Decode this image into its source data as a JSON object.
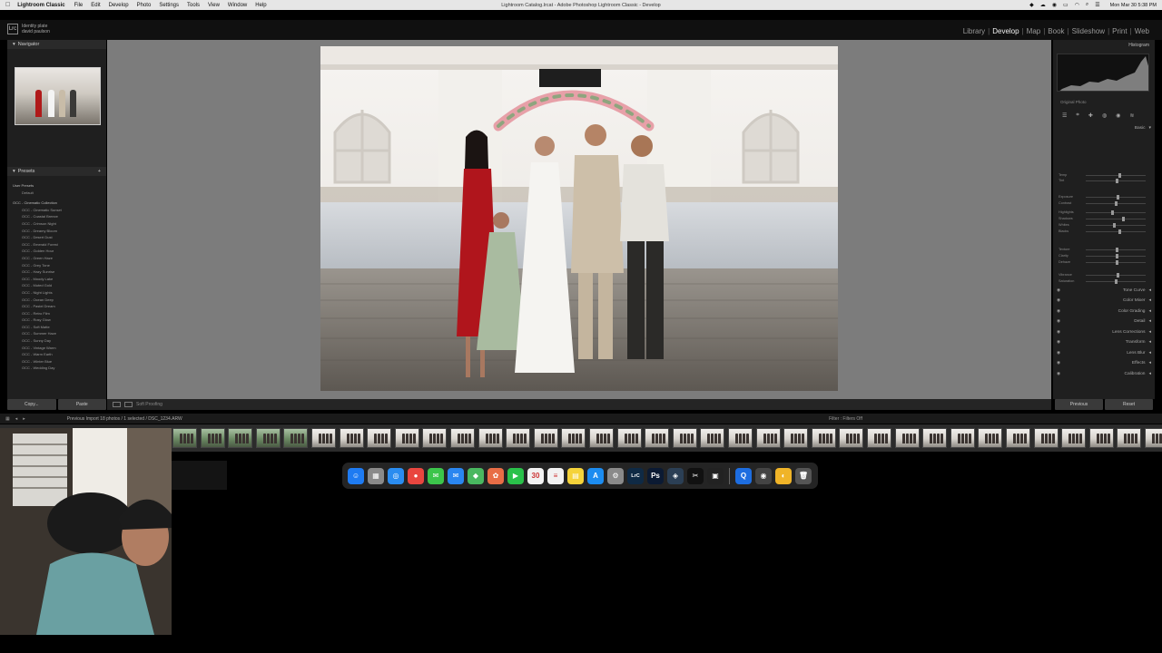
{
  "menubar": {
    "apple_icon": "apple-logo",
    "app_name": "Lightroom Classic",
    "items": [
      "File",
      "Edit",
      "Develop",
      "Photo",
      "Settings",
      "Tools",
      "View",
      "Window",
      "Help"
    ],
    "window_title": "Lightroom Catalog.lrcat - Adobe Photoshop Lightroom Classic - Develop",
    "clock": "Mon Mar 30  5:38 PM"
  },
  "identity_plate": {
    "logo": "Lrc",
    "line1": "Identity plate",
    "line2": "david paulson"
  },
  "modules": [
    {
      "label": "Library",
      "active": false
    },
    {
      "label": "Develop",
      "active": true
    },
    {
      "label": "Map",
      "active": false
    },
    {
      "label": "Book",
      "active": false
    },
    {
      "label": "Slideshow",
      "active": false
    },
    {
      "label": "Print",
      "active": false
    },
    {
      "label": "Web",
      "active": false
    }
  ],
  "left_panel": {
    "navigator_label": "Navigator",
    "presets_label": "Presets",
    "folders": [
      "User Presets",
      "OCC - Cinematic Collection"
    ],
    "user_presets": [
      "Default"
    ],
    "presets": [
      "OCC - Cinematic Sunset",
      "OCC - Coastal Breeze",
      "OCC - Crimson Night",
      "OCC - Dreamy Bloom",
      "OCC - Desert Dust",
      "OCC - Emerald Forest",
      "OCC - Golden Hour",
      "OCC - Green Haze",
      "OCC - Grey Tone",
      "OCC - Hazy Sunrise",
      "OCC - Moody Lake",
      "OCC - Muted Gold",
      "OCC - Night Lights",
      "OCC - Ocean Deep",
      "OCC - Pastel Dream",
      "OCC - Retro Film",
      "OCC - Rosy Glow",
      "OCC - Soft Matte",
      "OCC - Summer Haze",
      "OCC - Sunny Day",
      "OCC - Vintage Warm",
      "OCC - Warm Earth",
      "OCC - Winter Blue",
      "OCC - Wedding Day"
    ],
    "copy_label": "Copy...",
    "paste_label": "Paste"
  },
  "toolbar": {
    "soft_proofing": "Soft Proofing"
  },
  "right_panel": {
    "histogram_label": "Histogram",
    "original_photo": "Original Photo",
    "basic_label": "Basic",
    "sliders": [
      "Temp",
      "Tint",
      "Exposure",
      "Contrast",
      "Highlights",
      "Shadows",
      "Whites",
      "Blacks",
      "Texture",
      "Clarity",
      "Dehaze",
      "Vibrance",
      "Saturation"
    ],
    "sections": [
      "Tone Curve",
      "Color Mixer",
      "Color Grading",
      "Detail",
      "Lens Corrections",
      "Transform",
      "Lens Blur",
      "Effects",
      "Calibration"
    ],
    "previous_label": "Previous",
    "reset_label": "Reset"
  },
  "filmstrip": {
    "path": "Previous Import  18 photos / 1 selected / DSC_1234.ARW",
    "filter_label": "Filter :",
    "filter_value": "Filters Off"
  },
  "dock": {
    "apps": [
      {
        "name": "finder",
        "glyph": "☺",
        "color": "#1e7bf2"
      },
      {
        "name": "launchpad",
        "glyph": "▦",
        "color": "#8a8a8a"
      },
      {
        "name": "safari",
        "glyph": "◎",
        "color": "#2a8cf0"
      },
      {
        "name": "chrome",
        "glyph": "●",
        "color": "#e9463f"
      },
      {
        "name": "messages",
        "glyph": "✉",
        "color": "#3cc54b"
      },
      {
        "name": "mail",
        "glyph": "✉",
        "color": "#2a86f0"
      },
      {
        "name": "maps",
        "glyph": "◆",
        "color": "#49b860"
      },
      {
        "name": "photos",
        "glyph": "✿",
        "color": "#e86d46"
      },
      {
        "name": "facetime",
        "glyph": "▶",
        "color": "#2ac14a"
      },
      {
        "name": "calendar",
        "glyph": "30",
        "color": "#f2f2f2"
      },
      {
        "name": "reminders",
        "glyph": "≡",
        "color": "#f2f2f2"
      },
      {
        "name": "notes",
        "glyph": "▤",
        "color": "#f5d33a"
      },
      {
        "name": "app-store",
        "glyph": "A",
        "color": "#1c8cf0"
      },
      {
        "name": "system-settings",
        "glyph": "⚙",
        "color": "#8a8a8a"
      },
      {
        "name": "lightroom-classic",
        "glyph": "LrC",
        "color": "#0f2a45"
      },
      {
        "name": "photoshop",
        "glyph": "Ps",
        "color": "#0b1a33"
      },
      {
        "name": "davinci-resolve",
        "glyph": "◈",
        "color": "#2b3f55"
      },
      {
        "name": "capcut",
        "glyph": "✂",
        "color": "#111111"
      },
      {
        "name": "screen-recorder",
        "glyph": "▣",
        "color": "#222222"
      },
      {
        "name": "quicktime",
        "glyph": "Q",
        "color": "#1d6de0"
      },
      {
        "name": "chrome-alt",
        "glyph": "◉",
        "color": "#444444"
      },
      {
        "name": "keychain",
        "glyph": "◐",
        "color": "#f0b428"
      },
      {
        "name": "trash",
        "glyph": "🗑",
        "color": "#555555"
      }
    ]
  },
  "colors": {
    "menubar_bg": "#e6e6e6",
    "panel_bg": "#1f1f1f",
    "canvas_bg": "#7c7c7c",
    "active_module": "#f2f2f2"
  }
}
